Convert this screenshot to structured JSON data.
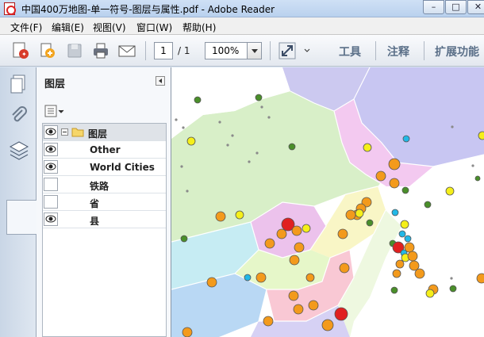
{
  "window": {
    "title": "中国400万地图-单一符号-图层与属性.pdf - Adobe Reader"
  },
  "window_controls": {
    "minimize": "–",
    "maximize": "□",
    "close": "✕"
  },
  "menu": [
    "文件(F)",
    "编辑(E)",
    "视图(V)",
    "窗口(W)",
    "帮助(H)"
  ],
  "toolbar": {
    "page_current": "1",
    "page_total": "/ 1",
    "zoom": "100%",
    "tools_label": "工具",
    "comment_label": "注释",
    "extend_label": "扩展功能"
  },
  "nav_icons": [
    "pages-icon",
    "attachments-icon",
    "layers-icon"
  ],
  "layers_panel": {
    "title": "图层",
    "layers": [
      {
        "name": "图层",
        "visible": true,
        "root": true
      },
      {
        "name": "Other",
        "visible": true
      },
      {
        "name": "World Cities",
        "visible": true
      },
      {
        "name": "铁路",
        "visible": false
      },
      {
        "name": "省",
        "visible": false
      },
      {
        "name": "县",
        "visible": true
      }
    ]
  },
  "colors": {
    "accent": "#5a6f88",
    "city_large": "#e02020",
    "city_medium": "#f39a1c",
    "city_small": "#f5ef1a",
    "city_green": "#4a8f2a",
    "city_cyan": "#22b8e6"
  }
}
